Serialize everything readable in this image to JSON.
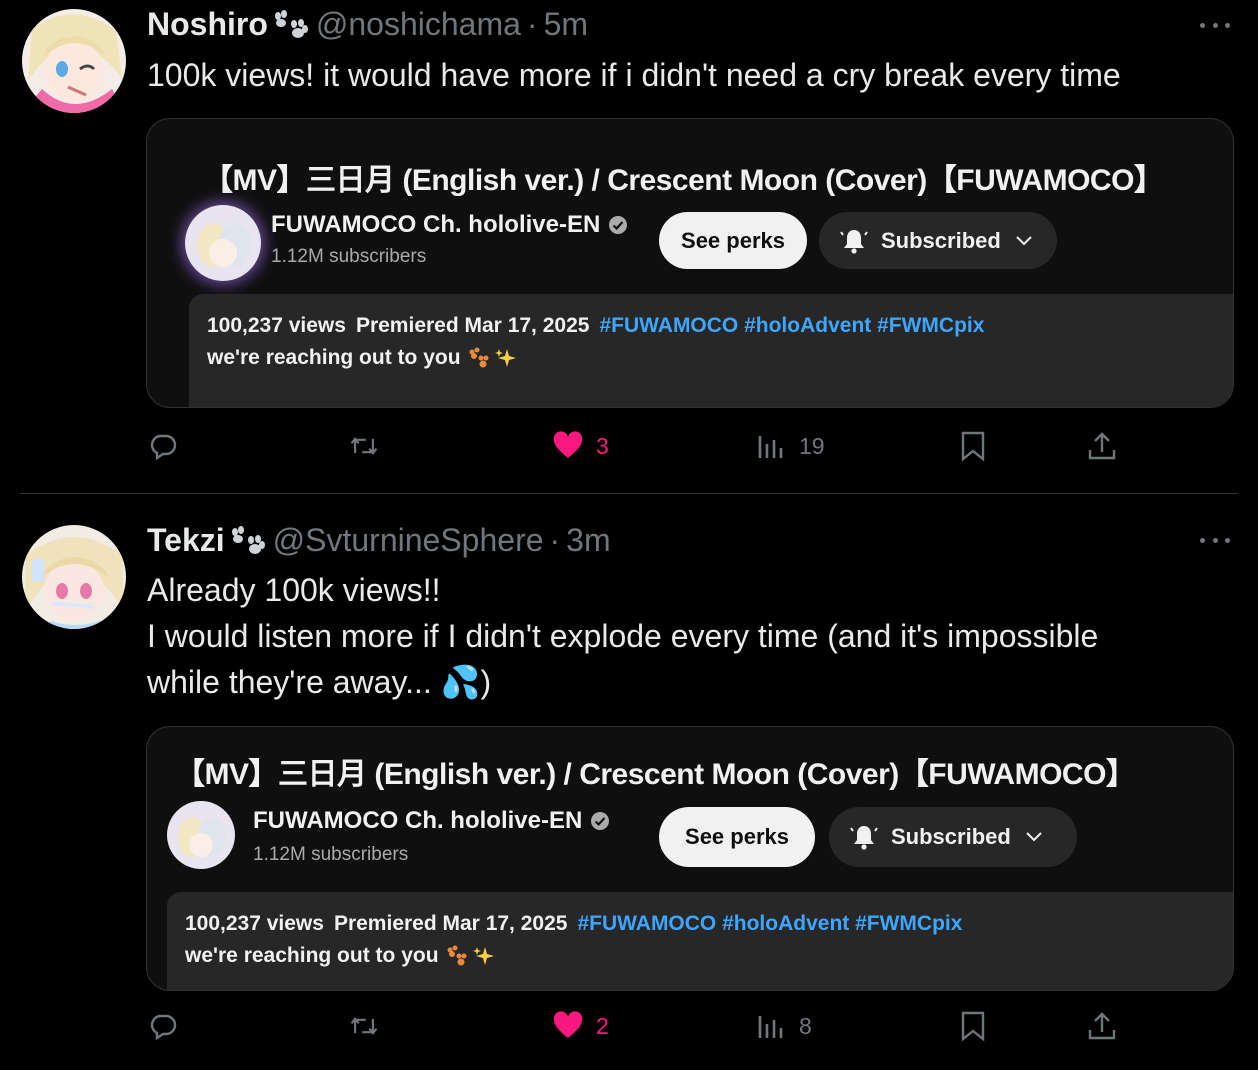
{
  "tweets": [
    {
      "name": "Noshiro",
      "handle": "@noshichama",
      "dot": "·",
      "time": "5m",
      "text_lines": [
        "100k views! it would have more if i didn't need a cry break every time"
      ],
      "card": {
        "title": "【MV】三日月 (English ver.) / Crescent Moon (Cover)【FUWAMOCO】",
        "channel_name": "FUWAMOCO Ch. hololive-EN",
        "subscribers": "1.12M subscribers",
        "perks_label": "See perks",
        "subscribed_label": "Subscribed",
        "views": "100,237 views",
        "premiered": "Premiered Mar 17, 2025",
        "hashtags": "#FUWAMOCO #holoAdvent #FWMCpix",
        "description": "we're reaching out to you"
      },
      "likes": "3",
      "view_count": "19"
    },
    {
      "name": "Tekzi",
      "handle": "@SvturnineSphere",
      "dot": "·",
      "time": "3m",
      "text_lines": [
        "Already 100k views!!",
        "I would listen more if I didn't explode every time (and it's impossible",
        "while they're away... 💦)"
      ],
      "card": {
        "title": "【MV】三日月 (English ver.) / Crescent Moon (Cover)【FUWAMOCO】",
        "channel_name": "FUWAMOCO Ch. hololive-EN",
        "subscribers": "1.12M subscribers",
        "perks_label": "See perks",
        "subscribed_label": "Subscribed",
        "views": "100,237 views",
        "premiered": "Premiered Mar 17, 2025",
        "hashtags": "#FUWAMOCO #holoAdvent #FWMCpix",
        "description": "we're reaching out to you"
      },
      "likes": "2",
      "view_count": "8"
    }
  ],
  "colors": {
    "background": "#000000",
    "like_pink": "#f91880",
    "muted": "#71767b",
    "hashtag_blue": "#3ea6ff"
  },
  "icons": [
    "paw-icon",
    "more-icon",
    "verified-icon",
    "bell-icon",
    "chevron-down-icon",
    "reply-icon",
    "retweet-icon",
    "heart-icon",
    "views-icon",
    "bookmark-icon",
    "share-icon",
    "paw-emoji-icon",
    "sparkles-emoji-icon"
  ]
}
